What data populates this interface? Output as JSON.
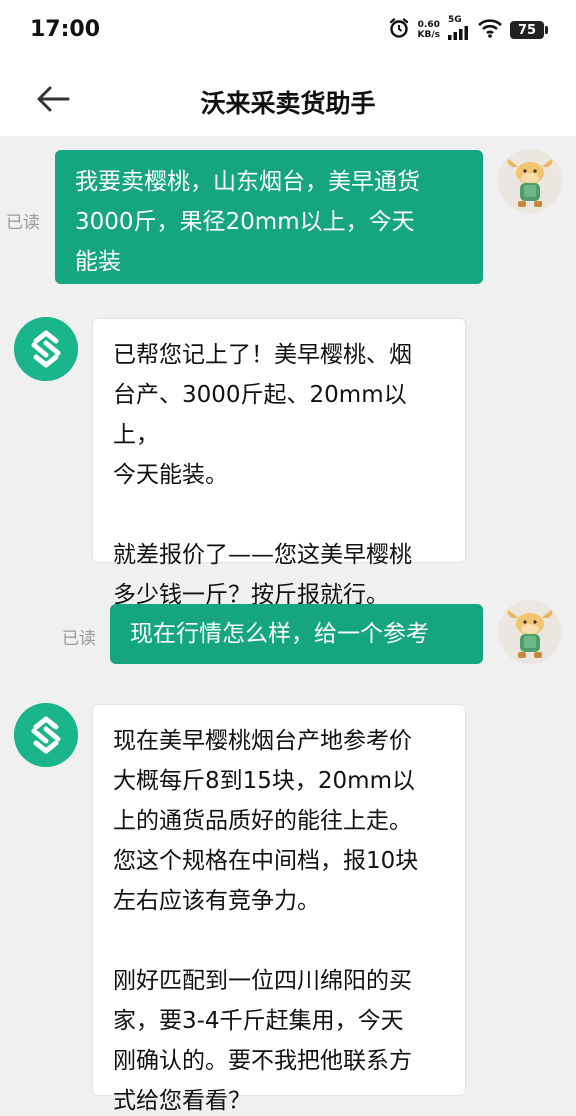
{
  "status": {
    "time": "17:00",
    "net_speed_value": "0.60",
    "net_speed_unit": "KB/s",
    "network": "5G",
    "battery": "75",
    "icons": [
      "alarm-icon",
      "signal-icon",
      "wifi-icon",
      "battery-icon"
    ]
  },
  "header": {
    "title": "沃来采卖货助手",
    "back_icon": "arrow-left-icon"
  },
  "messages": [
    {
      "sender": "user",
      "read_label": "已读",
      "lines": [
        "我要卖樱桃，山东烟台，美早通货",
        "3000斤，果径20mm以上，今天",
        "能装"
      ]
    },
    {
      "sender": "bot",
      "paragraphs": [
        [
          "已帮您记上了！美早樱桃、烟",
          "台产、3000斤起、20mm以上，",
          "今天能装。"
        ],
        [
          "就差报价了——您这美早樱桃",
          "多少钱一斤？按斤报就行。"
        ]
      ]
    },
    {
      "sender": "user",
      "read_label": "已读",
      "lines": [
        "现在行情怎么样，给一个参考"
      ]
    },
    {
      "sender": "bot",
      "paragraphs": [
        [
          "现在美早樱桃烟台产地参考价",
          "大概每斤8到15块，20mm以",
          "上的通货品质好的能往上走。",
          "您这个规格在中间档，报10块",
          "左右应该有竞争力。"
        ],
        [
          "刚好匹配到一位四川绵阳的买",
          "家，要3-4千斤赶集用，今天",
          "刚确认的。要不我把他联系方",
          "式给您看看？"
        ]
      ]
    }
  ],
  "colors": {
    "accent": "#16a581",
    "background": "#f0f0f0",
    "bot_avatar": "#1bb58c"
  }
}
